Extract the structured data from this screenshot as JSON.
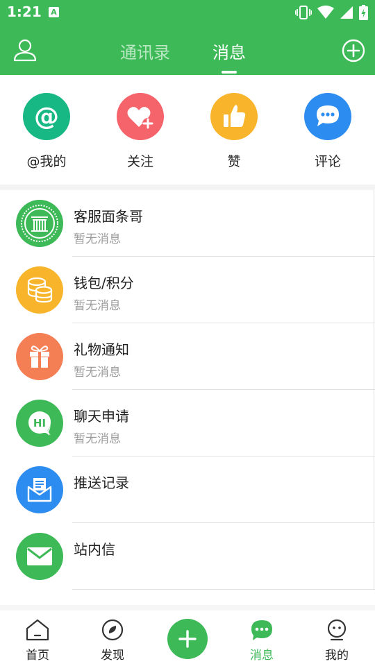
{
  "status_bar": {
    "time": "1:21",
    "notification_letter": "A"
  },
  "header": {
    "tabs": [
      {
        "label": "通讯录",
        "active": false
      },
      {
        "label": "消息",
        "active": true
      }
    ]
  },
  "quick_actions": [
    {
      "label": "@我的",
      "icon": "at-icon",
      "color": "#17b883"
    },
    {
      "label": "关注",
      "icon": "heart-plus-icon",
      "color": "#f5646a"
    },
    {
      "label": "赞",
      "icon": "thumbs-up-icon",
      "color": "#f8b42b"
    },
    {
      "label": "评论",
      "icon": "comment-bubble-icon",
      "color": "#2d8cef"
    }
  ],
  "messages": [
    {
      "title": "客服面条哥",
      "subtitle": "暂无消息",
      "icon": "customer-service-logo-icon",
      "color": "#3dba57"
    },
    {
      "title": "钱包/积分",
      "subtitle": "暂无消息",
      "icon": "coins-icon",
      "color": "#f8b42b"
    },
    {
      "title": "礼物通知",
      "subtitle": "暂无消息",
      "icon": "gift-icon",
      "color": "#f47f55"
    },
    {
      "title": "聊天申请",
      "subtitle": "暂无消息",
      "icon": "chat-hi-icon",
      "color": "#3dba57"
    },
    {
      "title": "推送记录",
      "subtitle": "",
      "icon": "envelope-document-icon",
      "color": "#2d8cef"
    },
    {
      "title": "站内信",
      "subtitle": "",
      "icon": "envelope-icon",
      "color": "#3dba57"
    }
  ],
  "bottom_nav": [
    {
      "label": "首页",
      "icon": "home-icon",
      "active": false
    },
    {
      "label": "发现",
      "icon": "discover-icon",
      "active": false
    },
    {
      "label": "消息",
      "icon": "message-dots-icon",
      "active": true
    },
    {
      "label": "我的",
      "icon": "profile-face-icon",
      "active": false
    }
  ],
  "colors": {
    "primary": "#3dba57",
    "subtitle_gray": "#9b9b9b"
  }
}
